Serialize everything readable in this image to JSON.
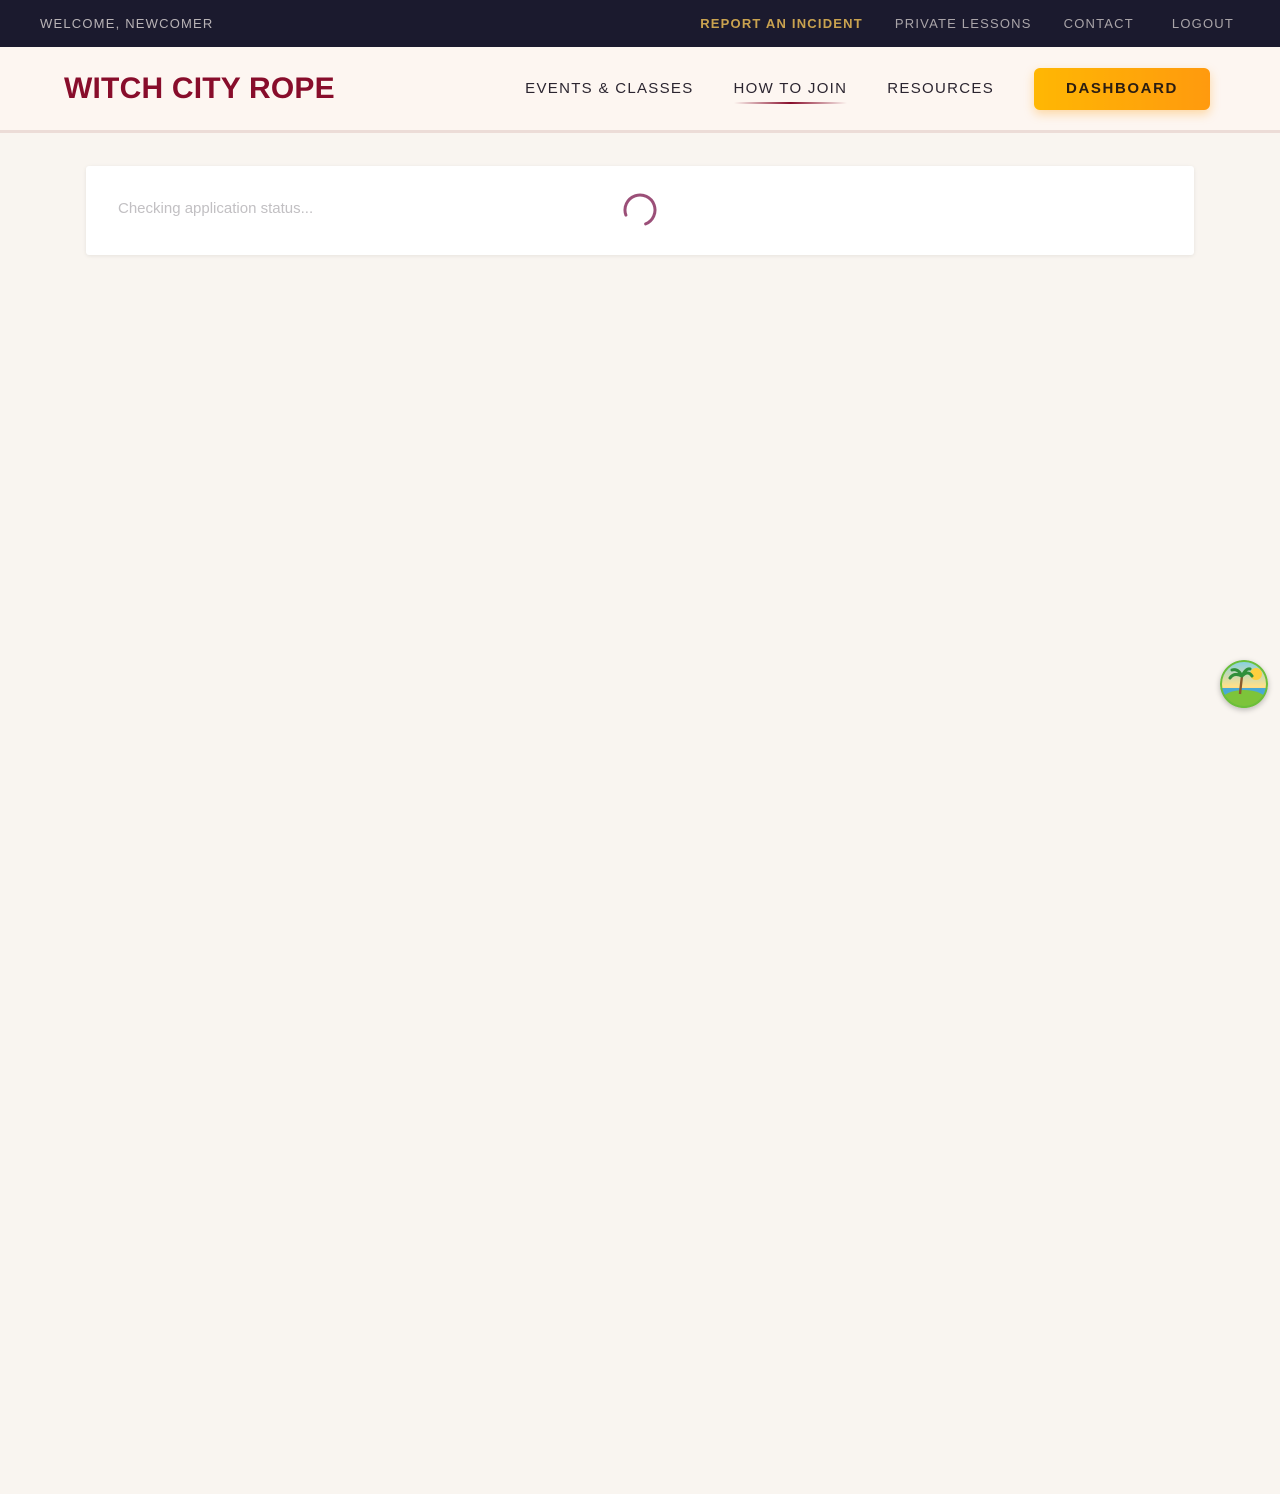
{
  "topbar": {
    "welcome": "WELCOME, NEWCOMER",
    "links": {
      "report_incident": "REPORT AN INCIDENT",
      "private_lessons": "PRIVATE LESSONS",
      "contact": "CONTACT",
      "logout": "LOGOUT"
    }
  },
  "header": {
    "logo": "WITCH CITY ROPE",
    "nav": {
      "events": "EVENTS & CLASSES",
      "how_to_join": "HOW TO JOIN",
      "resources": "RESOURCES"
    },
    "active_nav": "HOW TO JOIN",
    "dashboard_button": "DASHBOARD"
  },
  "status": {
    "message": "Checking application status..."
  },
  "floating_widget": {
    "icon": "palm-island-icon"
  },
  "colors": {
    "topbar_bg": "#1b1a2e",
    "incident_link": "#c9a24f",
    "logo": "#880d2b",
    "accent_button": "#ffb703",
    "page_bg": "#f9f5f0",
    "spinner": "#9b4f78"
  }
}
